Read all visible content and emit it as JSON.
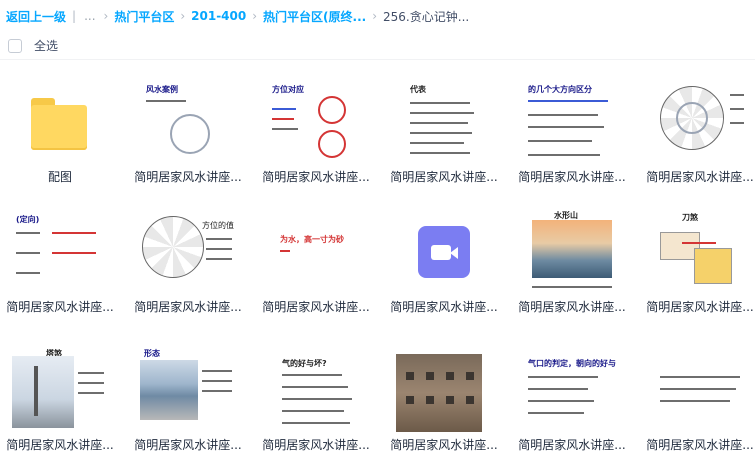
{
  "breadcrumb": {
    "back_label": "返回上一级",
    "ellipsis": "...",
    "items": [
      "热门平台区",
      "201-400",
      "热门平台区(原终..."
    ],
    "current": "256.贪心记钟..."
  },
  "toolbar": {
    "select_all_label": "全选"
  },
  "files": [
    {
      "name": "配图",
      "kind": "folder"
    },
    {
      "name": "简明居家风水讲座...",
      "kind": "doc",
      "snippet": "风水案例"
    },
    {
      "name": "简明居家风水讲座...",
      "kind": "doc",
      "snippet": "方位对应"
    },
    {
      "name": "简明居家风水讲座...",
      "kind": "doc",
      "snippet": "代表"
    },
    {
      "name": "简明居家风水讲座...",
      "kind": "doc",
      "snippet": "的几个大方向区分"
    },
    {
      "name": "简明居家风水讲座...",
      "kind": "doc",
      "snippet": ""
    },
    {
      "name": "简明居家风水讲座...",
      "kind": "doc",
      "snippet": "(定向)"
    },
    {
      "name": "简明居家风水讲座...",
      "kind": "doc",
      "snippet": "方位的值"
    },
    {
      "name": "简明居家风水讲座...",
      "kind": "doc",
      "snippet": "为水，高一寸为砂"
    },
    {
      "name": "简明居家风水讲座...",
      "kind": "video",
      "snippet": ""
    },
    {
      "name": "简明居家风水讲座...",
      "kind": "doc",
      "snippet": "水形山"
    },
    {
      "name": "简明居家风水讲座...",
      "kind": "doc",
      "snippet": "刀煞"
    },
    {
      "name": "简明居家风水讲座...",
      "kind": "doc",
      "snippet": "塔煞"
    },
    {
      "name": "简明居家风水讲座...",
      "kind": "doc",
      "snippet": "形态"
    },
    {
      "name": "简明居家风水讲座...",
      "kind": "doc",
      "snippet": "气的好与坏?"
    },
    {
      "name": "简明居家风水讲座...",
      "kind": "doc",
      "snippet": ""
    },
    {
      "name": "简明居家风水讲座...",
      "kind": "doc",
      "snippet": "气口的判定，朝向的好与"
    },
    {
      "name": "简明居家风水讲座...",
      "kind": "doc",
      "snippet": ""
    }
  ]
}
